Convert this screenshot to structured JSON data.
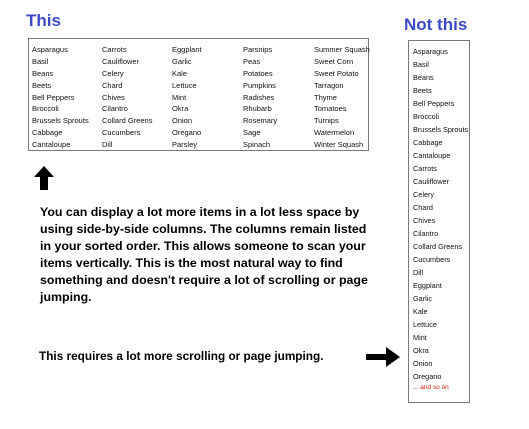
{
  "this_heading": "This",
  "not_this_heading": "Not this",
  "columns": [
    [
      "Asparagus",
      "Basil",
      "Beans",
      "Beets",
      "Bell Peppers",
      "Broccoli",
      "Brussels Sprouts",
      "Cabbage",
      "Cantaloupe"
    ],
    [
      "Carrots",
      "Cauliflower",
      "Celery",
      "Chard",
      "Chives",
      "Cilantro",
      "Collard Greens",
      "Cucumbers",
      "Dill"
    ],
    [
      "Eggplant",
      "Garlic",
      "Kale",
      "Lettuce",
      "Mint",
      "Okra",
      "Onion",
      "Oregano",
      "Parsley"
    ],
    [
      "Parsnips",
      "Peas",
      "Potatoes",
      "Pumpkins",
      "Radishes",
      "Rhubarb",
      "Rosemary",
      "Sage",
      "Spinach"
    ],
    [
      "Summer Squash",
      "Sweet Corn",
      "Sweet Potato",
      "Tarragon",
      "Thyme",
      "Tomatoes",
      "Turnips",
      "Watermelon",
      "Winter Squash"
    ]
  ],
  "single_list": [
    "Asparagus",
    "Basil",
    "Beans",
    "Beets",
    "Bell Peppers",
    "Broccoli",
    "Brussels Sprouts",
    "Cabbage",
    "Cantaloupe",
    "Carrots",
    "Cauliflower",
    "Celery",
    "Chard",
    "Chives",
    "Cilantro",
    "Collard Greens",
    "Cucumbers",
    "Dill",
    "Eggplant",
    "Garlic",
    "Kale",
    "Lettuce",
    "Mint",
    "Okra",
    "Onion",
    "Oregano"
  ],
  "and_so_on": "... and so on",
  "explanation": "You can display a lot more items in a lot less space by using side-by-side columns. The columns remain listed in your sorted order. This allows someone to scan your items vertically. This is the most natural way to find something and doesn't require a lot of scrolling or page jumping.",
  "explanation2": "This requires a lot more scrolling or page jumping.",
  "colors": {
    "heading": "#3b4bc8",
    "and_so_on": "#cc2200",
    "border": "#7a7a7a"
  },
  "icons": [
    "up-arrow-icon",
    "right-arrow-icon"
  ]
}
